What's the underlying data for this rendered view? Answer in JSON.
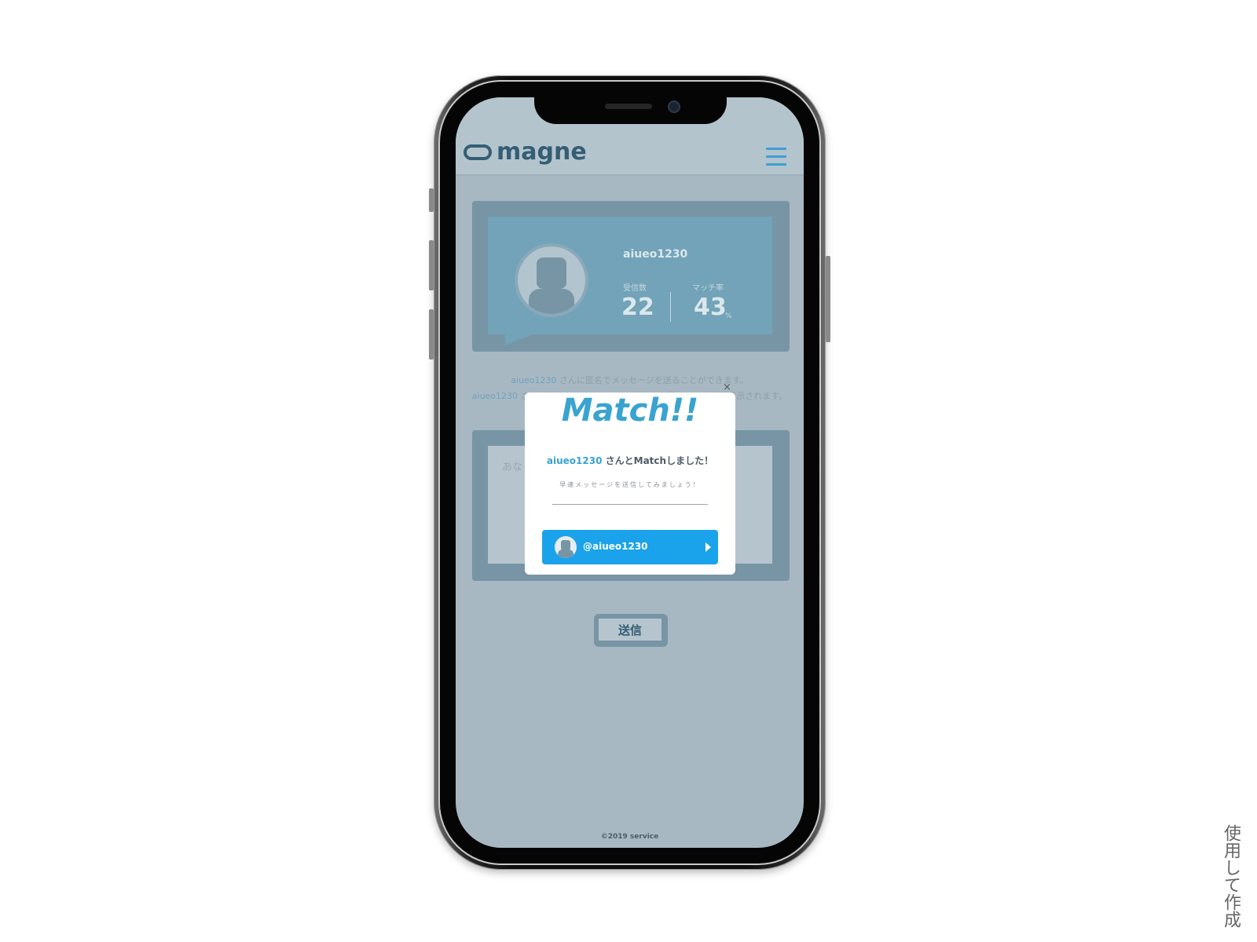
{
  "app": {
    "logo_text": "magne",
    "menu_icon": "hamburger-menu-icon"
  },
  "profile": {
    "username": "aiueo1230",
    "received_label": "受信数",
    "received_value": "22",
    "match_rate_label": "マッチ率",
    "match_rate_value": "43",
    "match_rate_unit": "%"
  },
  "info": {
    "line1_name": "aiueo1230",
    "line1_text": " さんに匿名でメッセージを送ることができます。",
    "line2_name": "aiueo1230",
    "line2_text": " さんがあなたにメッセージを送信した際にのみ名前が表示されます。"
  },
  "message": {
    "placeholder": "あな"
  },
  "send_button": {
    "label": "送信"
  },
  "footer": {
    "copyright": "©2019 service"
  },
  "modal": {
    "close_symbol": "×",
    "title": "Match!!",
    "match_name": "aiueo1230",
    "match_text": " さんとMatchしました！",
    "sub_text": "早速メッセージを送信してみましょう！",
    "link_label": "@aiueo1230"
  },
  "watermark": {
    "text": "使用して作成"
  },
  "colors": {
    "accent": "#3aa3d0",
    "button": "#1aa3ea",
    "overlay_background": "#a8b8c2"
  }
}
